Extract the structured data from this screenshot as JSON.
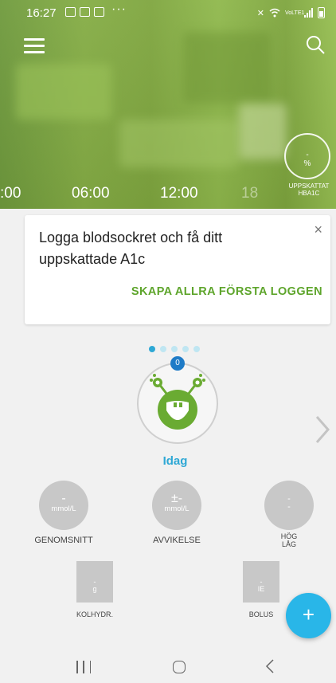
{
  "status_bar": {
    "time": "16:27",
    "more": "···",
    "network": "VoLTE1"
  },
  "header": {
    "timeline_ticks": [
      ":00",
      "06:00",
      "12:00",
      "18"
    ],
    "hba1c": {
      "value": "-\n%",
      "label": "UPPSKATTAT HBA1C"
    }
  },
  "card": {
    "message": "Logga blodsockret och få ditt uppskattade A1c",
    "action": "SKAPA ALLRA FÖRSTA LOGGEN",
    "close": "×"
  },
  "monster": {
    "badge": "0",
    "day_label": "Idag",
    "pages": 5,
    "active_page": 0
  },
  "stats": [
    {
      "value": "-",
      "unit": "mmol/L",
      "label": "GENOMSNITT"
    },
    {
      "value": "±-",
      "unit": "mmol/L",
      "label": "AVVIKELSE"
    },
    {
      "value": "-\n-",
      "unit": "",
      "label": "HÖG\nLÅG"
    }
  ],
  "entries": [
    {
      "value": "-\ng",
      "label": "KOLHYDR."
    },
    {
      "value": "-\nIE",
      "label": "BOLUS"
    }
  ],
  "fab_label": "+",
  "colors": {
    "accent_green": "#5ea52c",
    "accent_blue": "#2ea8d5",
    "fab": "#29b6e8"
  }
}
